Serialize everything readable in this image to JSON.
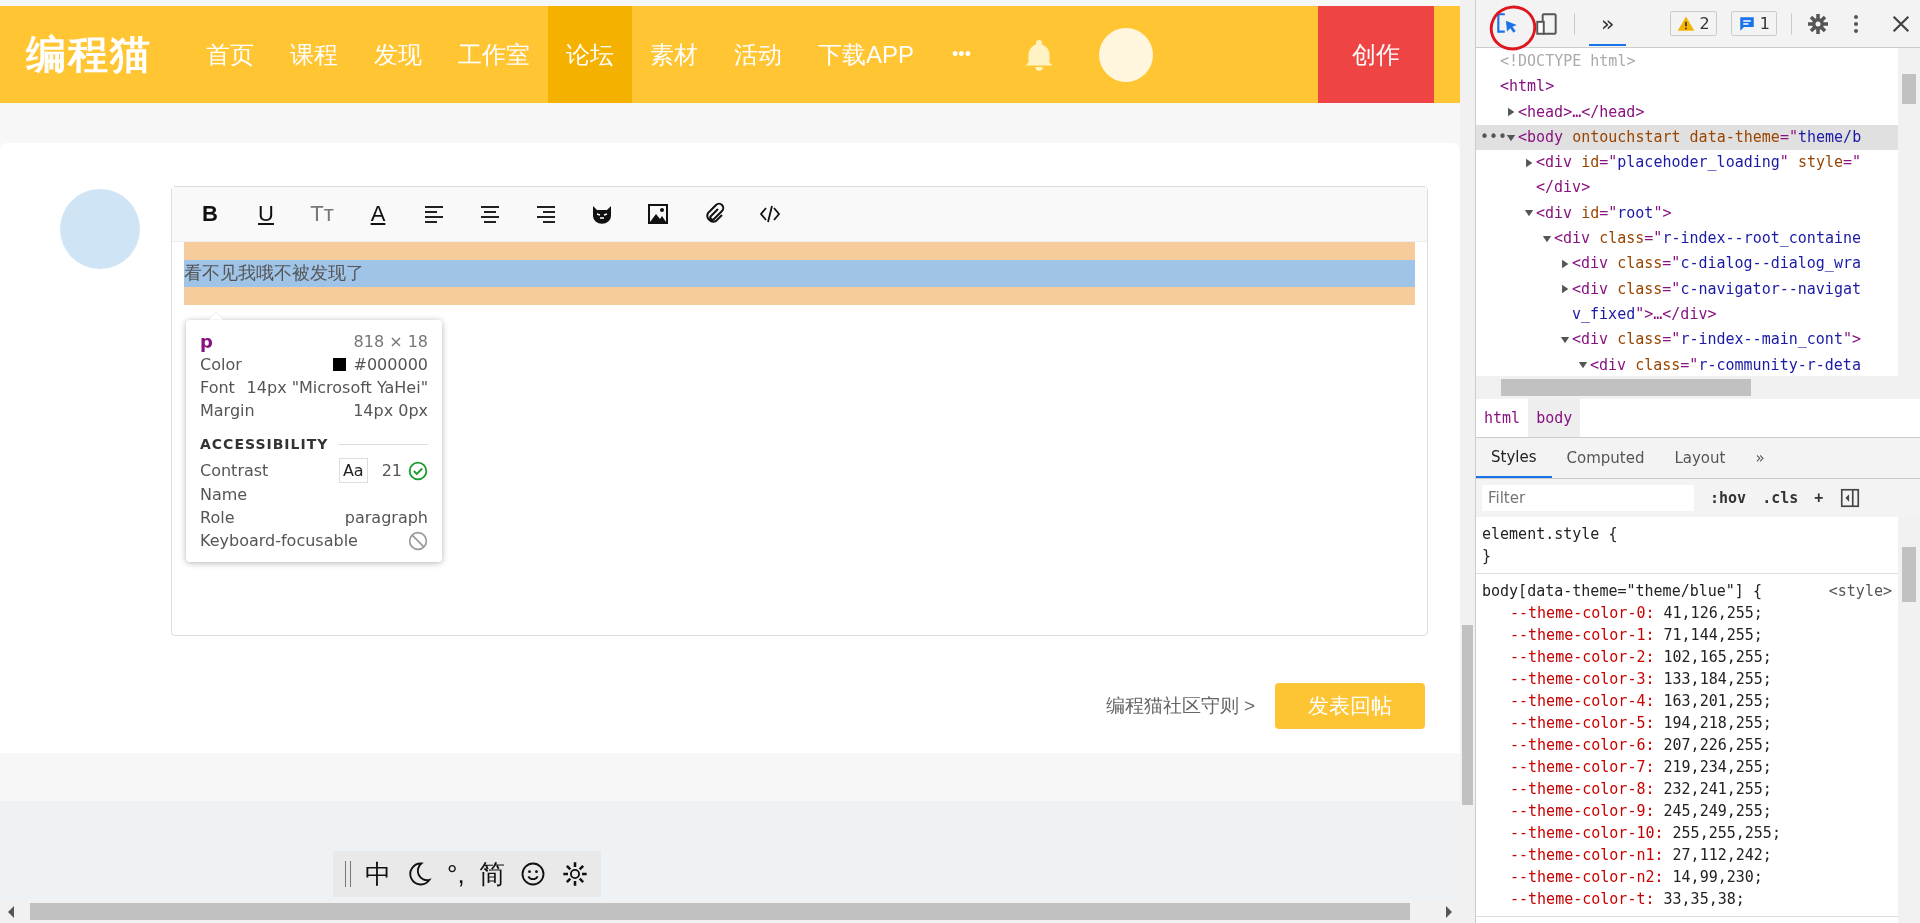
{
  "nav": {
    "logo": "编程猫",
    "items": [
      {
        "label": "首页",
        "selected": false
      },
      {
        "label": "课程",
        "selected": false
      },
      {
        "label": "发现",
        "selected": false
      },
      {
        "label": "工作室",
        "selected": false
      },
      {
        "label": "论坛",
        "selected": true
      },
      {
        "label": "素材",
        "selected": false
      },
      {
        "label": "活动",
        "selected": false
      },
      {
        "label": "下载APP",
        "selected": false
      }
    ],
    "more": "•••",
    "create": "创作"
  },
  "reply": {
    "toolbar": [
      {
        "kind": "bold",
        "label": "B"
      },
      {
        "kind": "underline",
        "label": "U"
      },
      {
        "kind": "size",
        "label": "Tт"
      },
      {
        "kind": "color",
        "label": "A"
      },
      {
        "kind": "align-left"
      },
      {
        "kind": "align-center"
      },
      {
        "kind": "align-right"
      },
      {
        "kind": "sticker"
      },
      {
        "kind": "image"
      },
      {
        "kind": "attachment"
      },
      {
        "kind": "code"
      }
    ],
    "paragraph": "看不见我哦不被发现了",
    "guide": "编程猫社区守则 >",
    "submit": "发表回帖"
  },
  "inspect_tooltip": {
    "tag": "p",
    "size": "818 × 18",
    "rows": [
      {
        "label": "Color",
        "value": "#000000",
        "color": "#000000"
      },
      {
        "label": "Font",
        "value": "14px \"Microsoft YaHei\""
      },
      {
        "label": "Margin",
        "value": "14px 0px"
      }
    ],
    "section": "ACCESSIBILITY",
    "accessibility": [
      {
        "kind": "contrast",
        "label": "Contrast",
        "sample": "Aa",
        "value": "21"
      },
      {
        "kind": "plain",
        "label": "Name"
      },
      {
        "kind": "plain",
        "label": "Role",
        "value": "paragraph"
      },
      {
        "kind": "blocked",
        "label": "Keyboard-focusable"
      }
    ]
  },
  "ime_bar": [
    {
      "kind": "text",
      "label": "中"
    },
    {
      "kind": "moon"
    },
    {
      "kind": "text",
      "label": "°,"
    },
    {
      "kind": "text",
      "label": "简"
    },
    {
      "kind": "smiley"
    },
    {
      "kind": "gear"
    }
  ],
  "devtools": {
    "more_tabs": "»",
    "warnings": "2",
    "messages": "1",
    "dom": [
      {
        "parts": [
          {
            "kind": "doc",
            "text": "<!DOCTYPE html>"
          }
        ]
      },
      {
        "parts": [
          {
            "kind": "tag",
            "text": "<html>"
          }
        ],
        "children": [
          {
            "expanded": false,
            "parts": [
              {
                "kind": "tag",
                "text": "<head>"
              },
              {
                "kind": "punct",
                "text": "…"
              },
              {
                "kind": "tag",
                "text": "</head>"
              }
            ]
          },
          {
            "expanded": true,
            "selected": true,
            "gutter": "•••",
            "parts": [
              {
                "kind": "tag",
                "text": "<body "
              },
              {
                "kind": "attr",
                "text": "ontouchstart data-theme"
              },
              {
                "kind": "tag",
                "text": "=\""
              },
              {
                "kind": "val",
                "text": "theme/b"
              }
            ],
            "children": [
              {
                "expanded": false,
                "parts": [
                  {
                    "kind": "tag",
                    "text": "<div "
                  },
                  {
                    "kind": "attr",
                    "text": "id"
                  },
                  {
                    "kind": "tag",
                    "text": "=\""
                  },
                  {
                    "kind": "val",
                    "text": "placehoder_loading"
                  },
                  {
                    "kind": "tag",
                    "text": "\" "
                  },
                  {
                    "kind": "attr",
                    "text": "style"
                  },
                  {
                    "kind": "tag",
                    "text": "=\""
                  }
                ],
                "tail": [
                  {
                    "kind": "tag",
                    "text": "</div>"
                  }
                ]
              },
              {
                "expanded": true,
                "parts": [
                  {
                    "kind": "tag",
                    "text": "<div "
                  },
                  {
                    "kind": "attr",
                    "text": "id"
                  },
                  {
                    "kind": "tag",
                    "text": "=\""
                  },
                  {
                    "kind": "val",
                    "text": "root"
                  },
                  {
                    "kind": "tag",
                    "text": "\">"
                  }
                ],
                "children": [
                  {
                    "expanded": true,
                    "parts": [
                      {
                        "kind": "tag",
                        "text": "<div "
                      },
                      {
                        "kind": "attr",
                        "text": "class"
                      },
                      {
                        "kind": "tag",
                        "text": "=\""
                      },
                      {
                        "kind": "val",
                        "text": "r-index--root_containe"
                      }
                    ],
                    "children": [
                      {
                        "expanded": false,
                        "parts": [
                          {
                            "kind": "tag",
                            "text": "<div "
                          },
                          {
                            "kind": "attr",
                            "text": "class"
                          },
                          {
                            "kind": "tag",
                            "text": "=\""
                          },
                          {
                            "kind": "val",
                            "text": "c-dialog--dialog_wra"
                          }
                        ]
                      },
                      {
                        "expanded": false,
                        "parts": [
                          {
                            "kind": "tag",
                            "text": "<div "
                          },
                          {
                            "kind": "attr",
                            "text": "class"
                          },
                          {
                            "kind": "tag",
                            "text": "=\""
                          },
                          {
                            "kind": "val",
                            "text": "c-navigator--navigat"
                          }
                        ],
                        "tail": [
                          {
                            "kind": "val",
                            "text": "v_fixed"
                          },
                          {
                            "kind": "tag",
                            "text": "\">"
                          },
                          {
                            "kind": "punct",
                            "text": "…"
                          },
                          {
                            "kind": "tag",
                            "text": "</div>"
                          }
                        ]
                      },
                      {
                        "expanded": true,
                        "parts": [
                          {
                            "kind": "tag",
                            "text": "<div "
                          },
                          {
                            "kind": "attr",
                            "text": "class"
                          },
                          {
                            "kind": "tag",
                            "text": "=\""
                          },
                          {
                            "kind": "val",
                            "text": "r-index--main_cont"
                          },
                          {
                            "kind": "tag",
                            "text": "\">"
                          }
                        ],
                        "children": [
                          {
                            "expanded": true,
                            "parts": [
                              {
                                "kind": "tag",
                                "text": "<div "
                              },
                              {
                                "kind": "attr",
                                "text": "class"
                              },
                              {
                                "kind": "tag",
                                "text": "=\""
                              },
                              {
                                "kind": "val",
                                "text": "r-community-r-deta"
                              }
                            ]
                          }
                        ]
                      }
                    ]
                  }
                ]
              }
            ]
          }
        ]
      }
    ],
    "breadcrumbs": [
      {
        "label": "html",
        "selected": false
      },
      {
        "label": "body",
        "selected": true
      }
    ],
    "tabs": [
      {
        "label": "Styles",
        "selected": true
      },
      {
        "label": "Computed",
        "selected": false
      },
      {
        "label": "Layout",
        "selected": false
      }
    ],
    "filter": {
      "placeholder": "Filter"
    },
    "hov": ":hov",
    "cls": ".cls",
    "add": "+",
    "rules": [
      {
        "selector": "element.style {",
        "close": "}"
      },
      {
        "selector": "body[data-theme=\"theme/blue\"] {",
        "source": "<style>",
        "declarations": [
          {
            "name": "--theme-color-0:",
            "value": "41,126,255;"
          },
          {
            "name": "--theme-color-1:",
            "value": "71,144,255;"
          },
          {
            "name": "--theme-color-2:",
            "value": "102,165,255;"
          },
          {
            "name": "--theme-color-3:",
            "value": "133,184,255;"
          },
          {
            "name": "--theme-color-4:",
            "value": "163,201,255;"
          },
          {
            "name": "--theme-color-5:",
            "value": "194,218,255;"
          },
          {
            "name": "--theme-color-6:",
            "value": "207,226,255;"
          },
          {
            "name": "--theme-color-7:",
            "value": "219,234,255;"
          },
          {
            "name": "--theme-color-8:",
            "value": "232,241,255;"
          },
          {
            "name": "--theme-color-9:",
            "value": "245,249,255;"
          },
          {
            "name": "--theme-color-10:",
            "value": "255,255,255;"
          },
          {
            "name": "--theme-color-n1:",
            "value": "27,112,242;"
          },
          {
            "name": "--theme-color-n2:",
            "value": "14,99,230;"
          },
          {
            "name": "--theme-color-t:",
            "value": "33,35,38;"
          }
        ]
      }
    ]
  }
}
